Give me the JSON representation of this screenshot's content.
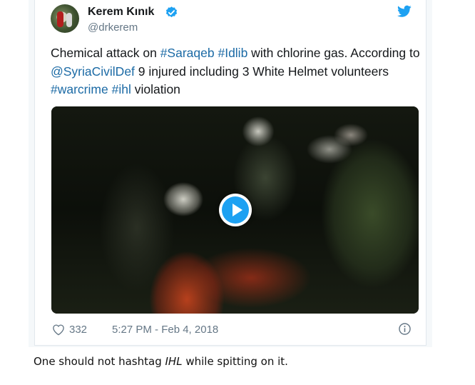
{
  "tweet": {
    "display_name": "Kerem Kınık",
    "handle": "@drkerem",
    "text_segments": [
      {
        "text": "Chemical attack on ",
        "link": false
      },
      {
        "text": "#Saraqeb",
        "link": true
      },
      {
        "text": " ",
        "link": false
      },
      {
        "text": "#Idlib",
        "link": true
      },
      {
        "text": " with chlorine gas. According to ",
        "link": false
      },
      {
        "text": "@SyriaCivilDef",
        "link": true
      },
      {
        "text": " 9 injured including 3 White Helmet volunteers ",
        "link": false
      },
      {
        "text": "#warcrime",
        "link": true
      },
      {
        "text": " ",
        "link": false
      },
      {
        "text": "#ihl",
        "link": true
      },
      {
        "text": " violation",
        "link": false
      }
    ],
    "like_count": "332",
    "timestamp": "5:27 PM - Feb 4, 2018",
    "icons": {
      "verified": "verified-badge-icon",
      "logo": "twitter-bird-icon",
      "play": "play-icon",
      "like": "heart-icon",
      "info": "info-icon"
    }
  },
  "caption": {
    "before": "One should not hashtag ",
    "emphasis": "IHL",
    "after": " while spitting on it."
  },
  "colors": {
    "link": "#1b6aa5",
    "twitter_blue": "#1da1f2",
    "secondary_text": "#657786"
  }
}
